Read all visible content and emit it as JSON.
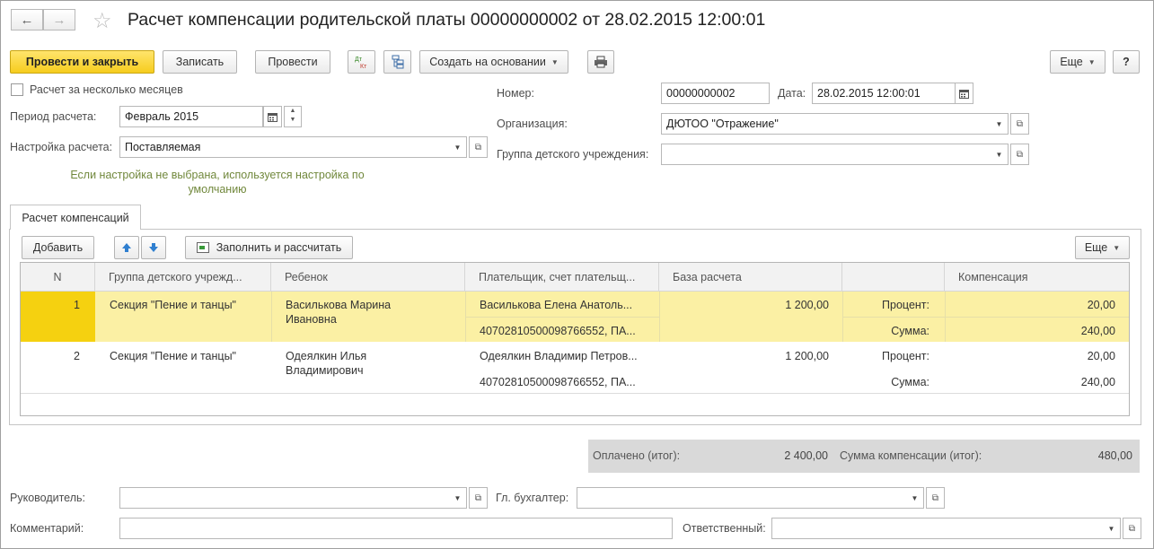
{
  "window": {
    "title": "Расчет компенсации родительской платы 00000000002 от 28.02.2015 12:00:01"
  },
  "icons": {
    "back": "arrow-left-icon",
    "forward": "arrow-right-icon",
    "favorite": "star-icon",
    "dtkt": "debit-credit-icon",
    "structure": "document-structure-icon",
    "print": "printer-icon",
    "move_up": "arrow-up-icon",
    "move_down": "arrow-down-icon",
    "fill": "fill-calculate-icon"
  },
  "toolbar": {
    "post_close": "Провести и закрыть",
    "save": "Записать",
    "post": "Провести",
    "dtkt_text": "Дт Кт",
    "create_based": "Создать на основании",
    "more": "Еще",
    "help": "?"
  },
  "form": {
    "multi_month_label": "Расчет за несколько месяцев",
    "multi_month_checked": false,
    "period_label": "Период расчета:",
    "period_value": "Февраль 2015",
    "setting_label": "Настройка расчета:",
    "setting_value": "Поставляемая",
    "setting_hint": "Если настройка не выбрана, используется настройка по умолчанию",
    "number_label": "Номер:",
    "number_value": "00000000002",
    "date_label": "Дата:",
    "date_value": "28.02.2015 12:00:01",
    "org_label": "Организация:",
    "org_value": "ДЮТОО \"Отражение\"",
    "group_label": "Группа детского учреждения:",
    "group_value": ""
  },
  "tab": {
    "label": "Расчет компенсаций",
    "add": "Добавить",
    "fill_calc": "Заполнить и рассчитать",
    "more": "Еще"
  },
  "table": {
    "headers": [
      "N",
      "Группа детского учрежд...",
      "Ребенок",
      "Плательщик, счет плательщ...",
      "База расчета",
      "",
      "Компенсация"
    ],
    "rows": [
      {
        "n": "1",
        "group": "Секция \"Пение и танцы\"",
        "child_line1": "Василькова Марина",
        "child_line2": "Ивановна",
        "payer": "Василькова Елена Анатоль...",
        "account": "40702810500098766552, ПА...",
        "base": "1 200,00",
        "label_percent": "Процент:",
        "percent": "20,00",
        "label_sum": "Сумма:",
        "sum": "240,00",
        "selected": true
      },
      {
        "n": "2",
        "group": "Секция \"Пение и танцы\"",
        "child_line1": "Одеялкин Илья",
        "child_line2": "Владимирович",
        "payer": "Одеялкин Владимир Петров...",
        "account": "40702810500098766552, ПА...",
        "base": "1 200,00",
        "label_percent": "Процент:",
        "percent": "20,00",
        "label_sum": "Сумма:",
        "sum": "240,00",
        "selected": false
      }
    ]
  },
  "totals": {
    "paid_label": "Оплачено (итог):",
    "paid_value": "2 400,00",
    "comp_label": "Сумма компенсации (итог):",
    "comp_value": "480,00"
  },
  "footer": {
    "head_label": "Руководитель:",
    "head_value": "",
    "accountant_label": "Гл. бухгалтер:",
    "accountant_value": "",
    "comment_label": "Комментарий:",
    "comment_value": "",
    "responsible_label": "Ответственный:",
    "responsible_value": ""
  },
  "colors": {
    "primary_button": "#f6cd1e",
    "selected_row": "#fbf0a4",
    "selected_cell": "#f5d110",
    "hint_text": "#71883c",
    "totals_bg": "#d9d9d9"
  }
}
